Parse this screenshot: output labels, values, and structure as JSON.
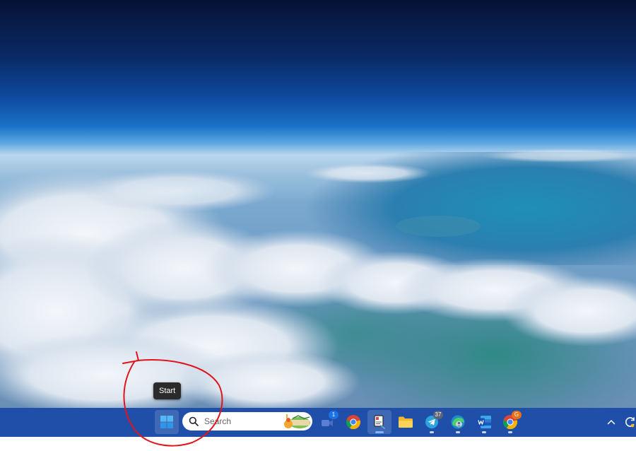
{
  "tooltip": {
    "text": "Start"
  },
  "search": {
    "placeholder": "Search"
  },
  "taskbar": {
    "meet_badge": "1",
    "telegram_badge": "37",
    "chrome_badge": "G"
  },
  "icons": {
    "start": "windows-logo-icon",
    "search": "magnifier-icon",
    "meet": "video-camera-icon",
    "chrome": "chrome-icon",
    "snip": "snipping-tool-icon",
    "files": "folder-icon",
    "telegram": "telegram-icon",
    "edge": "edge-profile-icon",
    "word": "word-icon",
    "tray": "chevron-up-icon"
  },
  "colors": {
    "taskbar": "#1f4fa8",
    "annotation": "#e0151b",
    "badge_blue": "#1a73e8",
    "badge_grey": "#5b6577",
    "badge_orange": "#e8711a"
  }
}
